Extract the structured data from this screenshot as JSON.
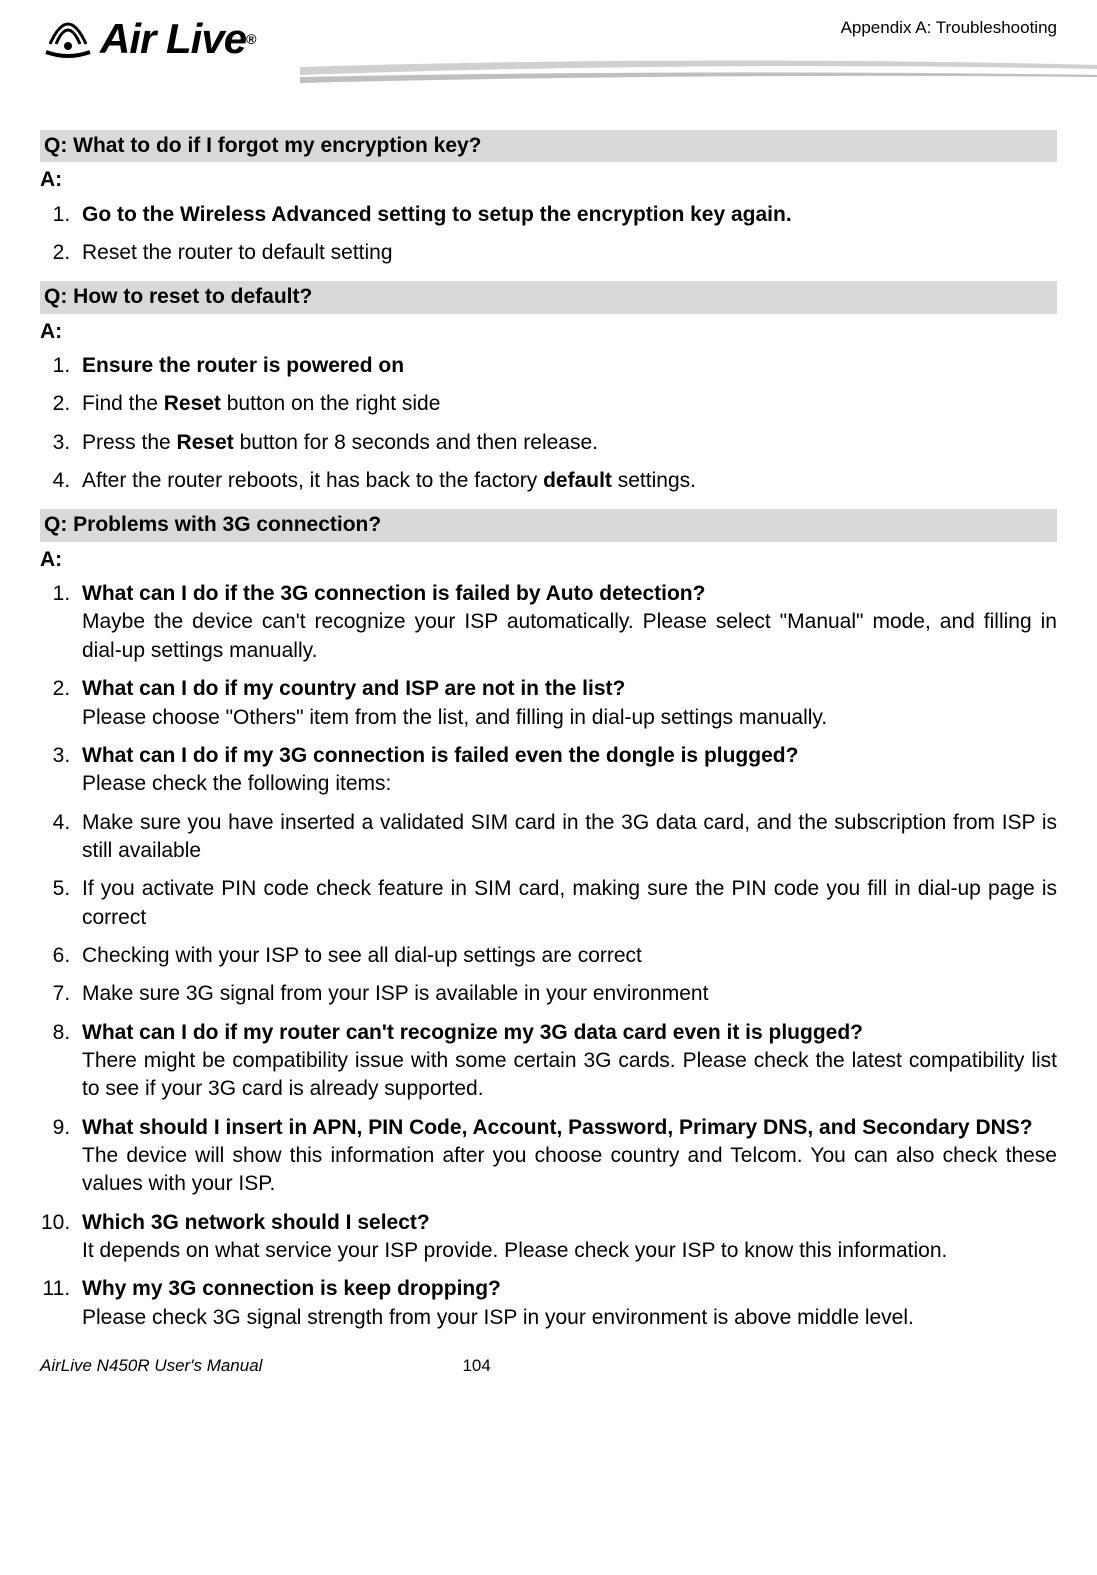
{
  "header": {
    "logo_text": "Air Live",
    "appendix": "Appendix A: Troubleshooting"
  },
  "qa": [
    {
      "question": "Q: What to do if I forgot my encryption key?",
      "answer_label": "A:",
      "items": [
        {
          "bold_full": true,
          "text": "Go to the Wireless Advanced setting to setup the encryption key again."
        },
        {
          "text": "Reset the router to default setting"
        }
      ]
    },
    {
      "question": "Q: How to reset to default?",
      "answer_label": "A:",
      "items": [
        {
          "bold_full": true,
          "text": "Ensure the router is powered on"
        },
        {
          "pre": "Find the ",
          "bold": "Reset",
          "post": " button on the right side"
        },
        {
          "pre": "Press the ",
          "bold": "Reset",
          "post": " button for 8 seconds and then release."
        },
        {
          "pre": "After the router reboots, it has back to the factory ",
          "bold": "default",
          "post": " settings."
        }
      ]
    },
    {
      "question": "Q: Problems with 3G connection?",
      "answer_label": "A:",
      "items": [
        {
          "bold_head": "What can I do if the 3G connection is failed by Auto detection?",
          "desc": "Maybe the device can't recognize your ISP automatically. Please select \"Manual\" mode, and filling in dial-up settings manually."
        },
        {
          "bold_head": "What can I do if my country and ISP are not in the list?",
          "desc": "Please choose \"Others\" item from the list, and filling in dial-up settings manually."
        },
        {
          "bold_head": "What can I do if my 3G connection is failed even the dongle is plugged?",
          "desc": "Please check the following items:"
        },
        {
          "text": "Make sure you have inserted a validated SIM card in the 3G data card, and the subscription from ISP is still available"
        },
        {
          "text": "If you activate PIN code check feature in SIM card, making sure the PIN code you fill in dial-up page is correct"
        },
        {
          "text": "Checking with your ISP to see all dial-up settings are correct"
        },
        {
          "text": "Make sure 3G signal from your ISP is available in your environment"
        },
        {
          "bold_head": "What can I do if my router can't recognize my 3G data card even it is plugged?",
          "desc": "There might be compatibility issue with some certain 3G cards. Please check the latest compatibility list to see if your 3G card is already supported."
        },
        {
          "bold_head": "What should I insert in APN, PIN Code, Account, Password, Primary DNS, and Secondary DNS?",
          "desc": "The device will show this information after you choose country and Telcom. You can also check these values with your ISP."
        },
        {
          "bold_head": "Which 3G network should I select?",
          "desc": "It depends on what service your ISP provide. Please check your ISP to know this information."
        },
        {
          "bold_head": "Why my 3G connection is keep dropping?",
          "desc": "Please check 3G signal strength from your ISP in your environment is above middle level."
        }
      ]
    }
  ],
  "footer": {
    "manual": "AirLive N450R User's Manual",
    "page": "104"
  }
}
